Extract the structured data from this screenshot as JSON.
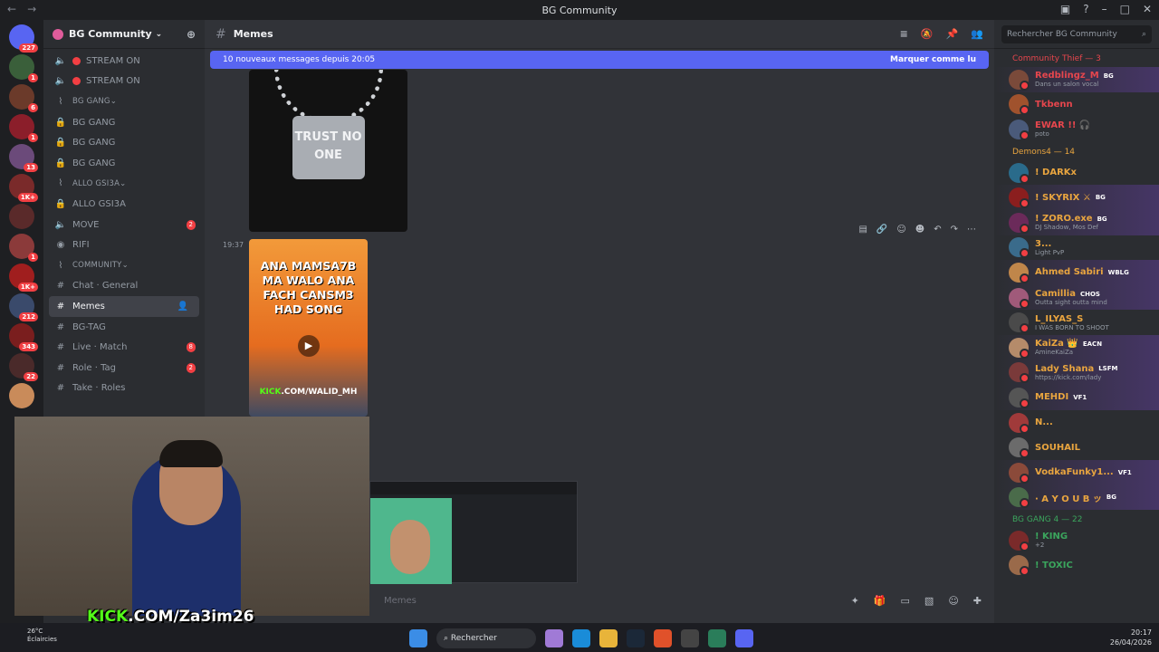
{
  "window": {
    "title": "BG Community"
  },
  "guild": {
    "name": "BG Community"
  },
  "channels": [
    {
      "kind": "voice-live",
      "label": "STREAM ON"
    },
    {
      "kind": "voice-live",
      "label": "STREAM ON"
    },
    {
      "kind": "category",
      "label": "BG GANG"
    },
    {
      "kind": "locked",
      "label": "BG GANG"
    },
    {
      "kind": "locked",
      "label": "BG GANG"
    },
    {
      "kind": "locked",
      "label": "BG GANG"
    },
    {
      "kind": "category",
      "label": "ALLO GSI3A"
    },
    {
      "kind": "locked",
      "label": "ALLO GSI3A"
    },
    {
      "kind": "voice",
      "label": "MOVE",
      "count": "2"
    },
    {
      "kind": "user",
      "label": "RIFI"
    },
    {
      "kind": "category",
      "label": "COMMUNITY"
    },
    {
      "kind": "text",
      "label": "Chat · General"
    },
    {
      "kind": "text-active",
      "label": "Memes"
    },
    {
      "kind": "text",
      "label": "BG-TAG"
    },
    {
      "kind": "text",
      "label": "Live · Match",
      "count": "8"
    },
    {
      "kind": "text",
      "label": "Role · Tag",
      "count": "2"
    },
    {
      "kind": "text",
      "label": "Take · Roles"
    }
  ],
  "server_badges": [
    "227",
    "1",
    "6",
    "1",
    "13",
    "1K+",
    "",
    "1",
    "1K+",
    "212",
    "343",
    "22",
    ""
  ],
  "header": {
    "channel": "Memes"
  },
  "banner": {
    "text": "10 nouveaux messages depuis 20:05",
    "action": "Marquer comme lu"
  },
  "messages": {
    "image1_text": "TRUST NO ONE",
    "time2": "19:37",
    "image2_text": "ANA MAMSA7B MA WALO ANA FACH CANSM3 HAD SONG",
    "image2_kick": "KICK",
    "image2_url": ".COM/WALID_MH"
  },
  "composer": {
    "placeholder": "Memes"
  },
  "stream": {
    "kick_prefix": "KICK",
    "kick_url": ".COM/Za3im26"
  },
  "search": {
    "placeholder": "Rechercher BG Community"
  },
  "member_groups": [
    {
      "title": "Community Thief — 3",
      "color": "#e6464d",
      "members": [
        {
          "name": "Redblingz_M",
          "tag": "BG",
          "sub": "Dans un salon vocal",
          "color": "#e6464d"
        },
        {
          "name": "Tkbenn",
          "tag": "",
          "sub": "",
          "color": "#e6464d"
        },
        {
          "name": "EWAR !! 🎧",
          "tag": "",
          "sub": "poto",
          "color": "#e6464d"
        }
      ]
    },
    {
      "title": "Demons4 — 14",
      "color": "#e9a53f",
      "members": [
        {
          "name": "! DARKx",
          "tag": "",
          "sub": "",
          "color": "#e9a53f"
        },
        {
          "name": "! SKYRIX ⚔",
          "tag": "BG",
          "sub": "",
          "color": "#e9a53f"
        },
        {
          "name": "! ZORO.exe",
          "tag": "BG",
          "sub": "DJ Shadow, Mos Def",
          "color": "#e9a53f"
        },
        {
          "name": "3...",
          "tag": "",
          "sub": "Light PvP",
          "color": "#e9a53f"
        },
        {
          "name": "Ahmed Sabiri",
          "tag": "WBLG",
          "sub": "",
          "color": "#e9a53f"
        },
        {
          "name": "Camillia",
          "tag": "CHOS",
          "sub": "Outta sight outta mind",
          "color": "#e9a53f"
        },
        {
          "name": "L_ILYAS_S",
          "tag": "",
          "sub": "I WAS BORN TO SHOOT",
          "color": "#e9a53f"
        },
        {
          "name": "KaiZa 👑",
          "tag": "EACN",
          "sub": "AmineKaiZa",
          "color": "#e9a53f"
        },
        {
          "name": "Lady Shana",
          "tag": "LSFM",
          "sub": "https://kick.com/lady",
          "color": "#e9a53f"
        },
        {
          "name": "MEHDI",
          "tag": "VF1",
          "sub": "",
          "color": "#e9a53f"
        },
        {
          "name": "N...",
          "tag": "",
          "sub": "",
          "color": "#e9a53f"
        },
        {
          "name": "SOUHAIL",
          "tag": "",
          "sub": "",
          "color": "#e9a53f"
        },
        {
          "name": "VodkaFunky1...",
          "tag": "VF1",
          "sub": "",
          "color": "#e9a53f"
        },
        {
          "name": "· A Y O U B ッ",
          "tag": "BG",
          "sub": "",
          "color": "#e9a53f"
        }
      ]
    },
    {
      "title": "BG GANG 4 — 22",
      "color": "#3ba55d",
      "members": [
        {
          "name": "! KING",
          "tag": "",
          "sub": "+2",
          "color": "#3ba55d"
        },
        {
          "name": "! TOXIC",
          "tag": "",
          "sub": "",
          "color": "#3ba55d"
        }
      ]
    }
  ],
  "taskbar": {
    "weather_temp": "26°C",
    "weather_text": "Éclaircies",
    "search": "Rechercher",
    "time": "20:17",
    "date": "26/04/2026"
  },
  "colors": {
    "accent": "#5865f2",
    "kick": "#53fc18",
    "danger": "#f23f43"
  }
}
